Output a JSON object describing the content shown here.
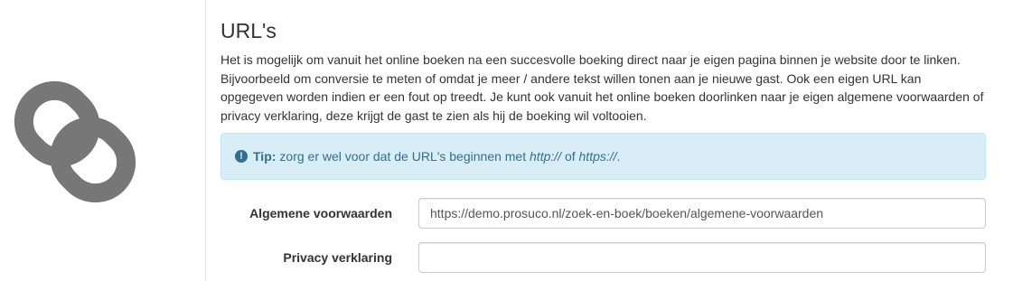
{
  "section": {
    "icon": "link-icon",
    "title": "URL's",
    "intro": "Het is mogelijk om vanuit het online boeken na een succesvolle boeking direct naar je eigen pagina binnen je website door te linken. Bijvoorbeeld om conversie te meten of omdat je meer / andere tekst willen tonen aan je nieuwe gast. Ook een eigen URL kan opgegeven worden indien er een fout op treedt. Je kunt ook vanuit het online boeken doorlinken naar je eigen algemene voorwaarden of privacy verklaring, deze krijgt de gast te zien als hij de boeking wil voltooien."
  },
  "tip": {
    "icon": "exclamation-circle-icon",
    "label": "Tip:",
    "text_before": "zorg er wel voor dat de URL's beginnen met",
    "http": "http://",
    "or": "of",
    "https": "https://",
    "end": "."
  },
  "form": {
    "fields": [
      {
        "label": "Algemene voorwaarden",
        "value": "https://demo.prosuco.nl/zoek-en-boek/boeken/algemene-voorwaarden"
      },
      {
        "label": "Privacy verklaring",
        "value": ""
      }
    ]
  },
  "colors": {
    "icon_gray": "#777777",
    "tip_background": "#d9edf7",
    "tip_text": "#31708f",
    "tip_border": "#bce8f1"
  }
}
